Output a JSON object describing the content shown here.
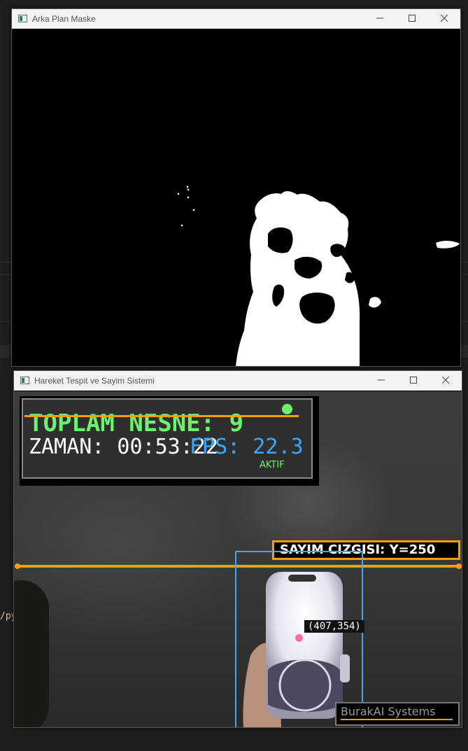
{
  "background_code_snippet": "/py",
  "mask_window": {
    "title": "Arka Plan Maske",
    "controls": {
      "minimize": "minimize",
      "maximize": "maximize",
      "close": "close"
    },
    "icon": "window-app-icon"
  },
  "tracking_window": {
    "title": "Hareket Tespit ve Sayim Sistemi",
    "icon": "window-app-icon",
    "hud": {
      "total_objects": "TOPLAM NESNE: 9",
      "time": "ZAMAN: 00:53:22",
      "fps": "FPS: 22.3",
      "status": "AKTIF",
      "status_color": "#6cf26c"
    },
    "counting_line_label": "SAYIM CIZGISI: Y=250",
    "object_coordinates": "(407,354)",
    "watermark": "BurakAI Systems",
    "colors": {
      "accent_orange": "#ff9f00",
      "box_blue": "#3aa8ff",
      "text_green": "#6cf26c",
      "centroid_pink": "#ff6fa8"
    }
  }
}
